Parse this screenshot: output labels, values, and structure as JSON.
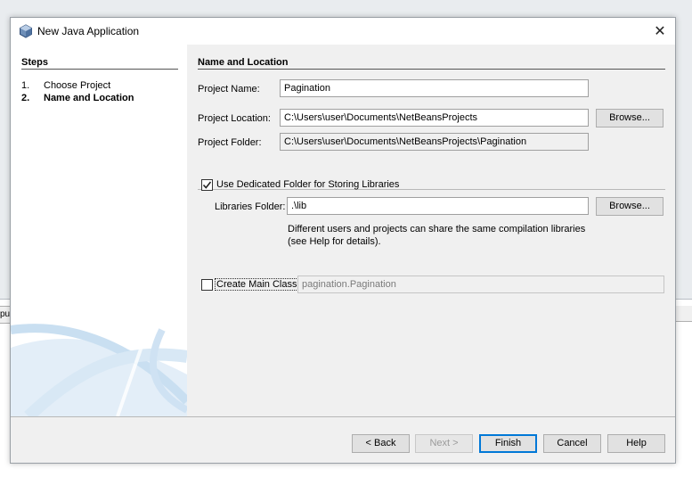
{
  "window": {
    "title": "New Java Application",
    "close_symbol": "✕"
  },
  "steps": {
    "title": "Steps",
    "items": [
      {
        "num": "1.",
        "label": "Choose Project"
      },
      {
        "num": "2.",
        "label": "Name and Location"
      }
    ]
  },
  "form": {
    "section_title": "Name and Location",
    "project_name_label": "Project Name:",
    "project_name_value": "Pagination",
    "project_location_label": "Project Location:",
    "project_location_value": "C:\\Users\\user\\Documents\\NetBeansProjects",
    "project_folder_label": "Project Folder:",
    "project_folder_value": "C:\\Users\\user\\Documents\\NetBeansProjects\\Pagination",
    "browse_label": "Browse...",
    "dedicated_folder_label": "Use Dedicated Folder for Storing Libraries",
    "dedicated_folder_checked": true,
    "libraries_folder_label": "Libraries Folder:",
    "libraries_folder_value": ".\\lib",
    "libraries_help_line1": "Different users and projects can share the same compilation libraries",
    "libraries_help_line2": "(see Help for details).",
    "create_main_class_label": "Create Main Class",
    "create_main_class_checked": false,
    "main_class_value": "pagination.Pagination"
  },
  "footer": {
    "back_label": "< Back",
    "next_label": "Next >",
    "finish_label": "Finish",
    "cancel_label": "Cancel",
    "help_label": "Help"
  },
  "background": {
    "tab_fragment": "pu"
  }
}
